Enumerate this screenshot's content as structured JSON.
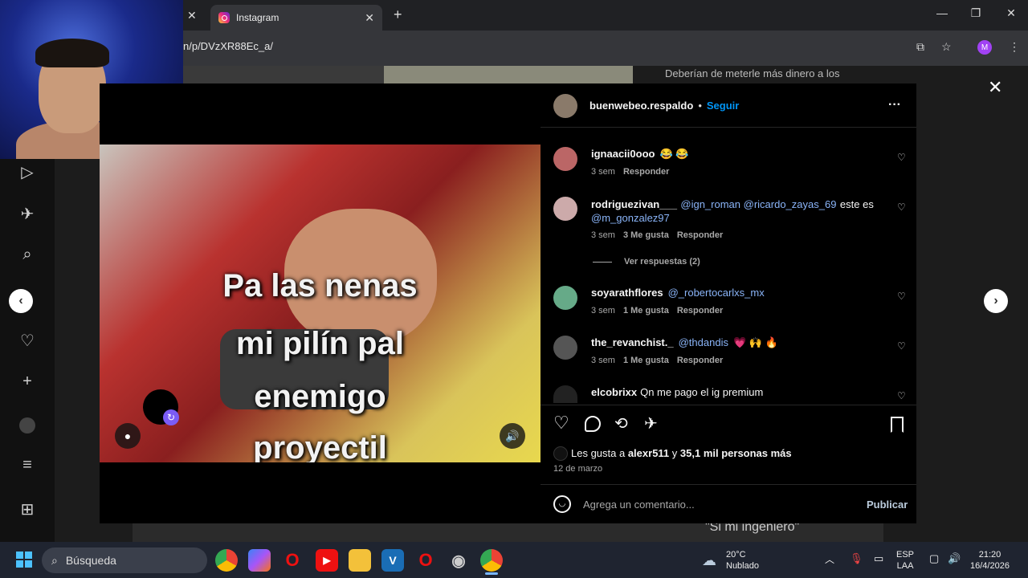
{
  "browser": {
    "tab_title": "Instagram",
    "url": "n/p/DVzXR88Ec_a/",
    "profile_initial": "M"
  },
  "background": {
    "top_text": "Deberían de meterle más dinero a los",
    "bottom_text": "\"Si mi ingeniero\""
  },
  "post": {
    "meme_lines": [
      "Pa las nenas",
      "mi pilín pal",
      "enemigo",
      "proyectil"
    ],
    "author": "buenwebeo.respaldo",
    "follow_label": "Seguir",
    "more_icon": "more-horizontal-icon",
    "comments": [
      {
        "user": "ignaacii0ooo",
        "text": "",
        "emoji": "😂 😂",
        "time": "3 sem",
        "likes": "",
        "reply": "Responder"
      },
      {
        "user": "rodriguezivan___",
        "mentions": "@ign_roman @ricardo_zayas_69",
        "text": "este es",
        "mention2": "@m_gonzalez97",
        "time": "3 sem",
        "likes": "3 Me gusta",
        "reply": "Responder"
      },
      {
        "user": "soyarathflores",
        "mentions": "@_robertocarlxs_mx",
        "time": "3 sem",
        "likes": "1 Me gusta",
        "reply": "Responder"
      },
      {
        "user": "the_revanchist._",
        "mentions": "@thdandis",
        "emoji": "💗 🙌 🔥",
        "time": "3 sem",
        "likes": "1 Me gusta",
        "reply": "Responder"
      },
      {
        "user": "elcobrixx",
        "text": "Qn me pago el ig premium"
      }
    ],
    "view_replies": "Ver respuestas (2)",
    "likes_text_prefix": "Les gusta a ",
    "likes_user": "alexr511",
    "likes_text_mid": " y ",
    "likes_count": "35,1 mil personas más",
    "date": "12 de marzo",
    "comment_placeholder": "Agrega un comentario...",
    "publish_label": "Publicar"
  },
  "taskbar": {
    "search_label": "Búsqueda",
    "weather_temp": "20°C",
    "weather_desc": "Nublado",
    "lang_1": "ESP",
    "lang_2": "LAA",
    "time": "21:20",
    "date": "16/4/2026"
  },
  "colors": {
    "accent": "#0095f6",
    "mention": "#8ab4f8",
    "panel_bg": "#000000",
    "taskbar_bg": "#1f2430"
  }
}
